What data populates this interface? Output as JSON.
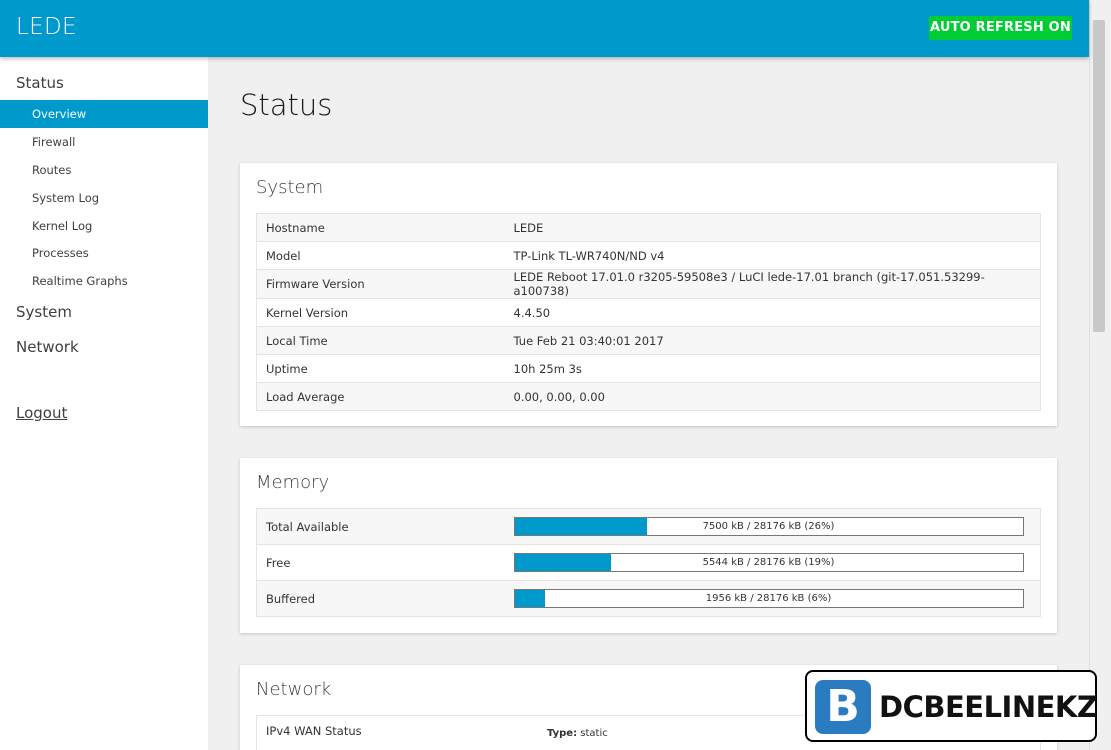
{
  "header": {
    "brand": "LEDE",
    "auto_refresh": "AUTO REFRESH ON"
  },
  "sidebar": {
    "status": "Status",
    "items": [
      "Overview",
      "Firewall",
      "Routes",
      "System Log",
      "Kernel Log",
      "Processes",
      "Realtime Graphs"
    ],
    "system": "System",
    "network": "Network",
    "logout": "Logout"
  },
  "page": {
    "title": "Status"
  },
  "system_panel": {
    "title": "System",
    "rows": [
      {
        "label": "Hostname",
        "value": "LEDE"
      },
      {
        "label": "Model",
        "value": "TP-Link TL-WR740N/ND v4"
      },
      {
        "label": "Firmware Version",
        "value": "LEDE Reboot 17.01.0 r3205-59508e3 / LuCI lede-17.01 branch (git-17.051.53299-a100738)"
      },
      {
        "label": "Kernel Version",
        "value": "4.4.50"
      },
      {
        "label": "Local Time",
        "value": "Tue Feb 21 03:40:01 2017"
      },
      {
        "label": "Uptime",
        "value": "10h 25m 3s"
      },
      {
        "label": "Load Average",
        "value": "0.00, 0.00, 0.00"
      }
    ]
  },
  "memory_panel": {
    "title": "Memory",
    "rows": [
      {
        "label": "Total Available",
        "text": "7500 kB / 28176 kB (26%)",
        "percent": 26
      },
      {
        "label": "Free",
        "text": "5544 kB / 28176 kB (19%)",
        "percent": 19
      },
      {
        "label": "Buffered",
        "text": "1956 kB / 28176 kB (6%)",
        "percent": 6
      }
    ]
  },
  "network_panel": {
    "title": "Network",
    "ipv4_label": "IPv4 WAN Status",
    "type_label": "Type:",
    "type_value": "static"
  },
  "watermark": {
    "letter": "B",
    "text": "DCBEELINEKZ"
  },
  "colors": {
    "accent": "#0099cc",
    "refresh": "#00cc33"
  }
}
